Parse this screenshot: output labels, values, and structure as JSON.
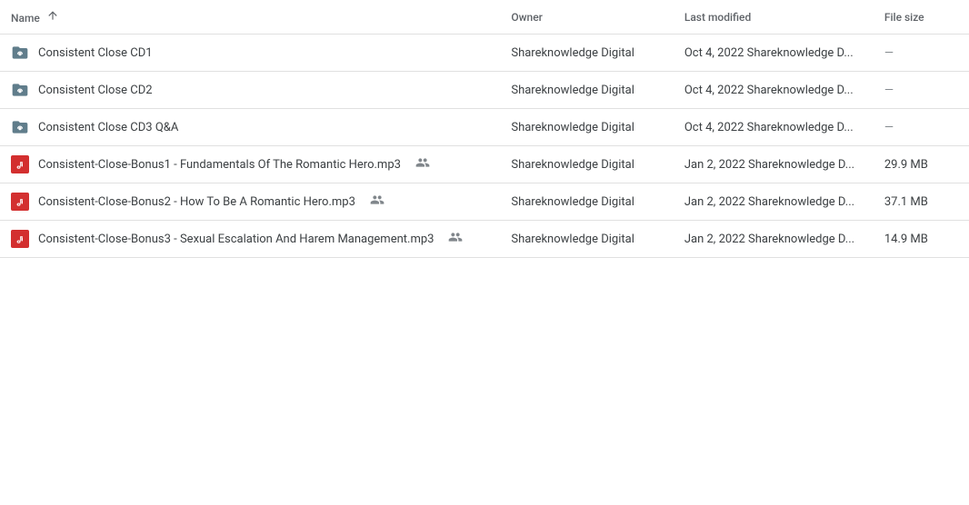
{
  "header": {
    "name_label": "Name",
    "owner_label": "Owner",
    "modified_label": "Last modified",
    "size_label": "File size"
  },
  "rows": [
    {
      "id": "row-1",
      "type": "folder",
      "name": "Consistent Close CD1",
      "has_shared": false,
      "owner": "Shareknowledge Digital",
      "modified": "Oct 4, 2022",
      "modified_by": "Shareknowledge D...",
      "size": "—"
    },
    {
      "id": "row-2",
      "type": "folder",
      "name": "Consistent Close CD2",
      "has_shared": false,
      "owner": "Shareknowledge Digital",
      "modified": "Oct 4, 2022",
      "modified_by": "Shareknowledge D...",
      "size": "—"
    },
    {
      "id": "row-3",
      "type": "folder",
      "name": "Consistent Close CD3 Q&A",
      "has_shared": false,
      "owner": "Shareknowledge Digital",
      "modified": "Oct 4, 2022",
      "modified_by": "Shareknowledge D...",
      "size": "—"
    },
    {
      "id": "row-4",
      "type": "mp3",
      "name": "Consistent-Close-Bonus1 - Fundamentals Of The Romantic Hero.mp3",
      "has_shared": true,
      "owner": "Shareknowledge Digital",
      "modified": "Jan 2, 2022",
      "modified_by": "Shareknowledge D...",
      "size": "29.9 MB"
    },
    {
      "id": "row-5",
      "type": "mp3",
      "name": "Consistent-Close-Bonus2 - How To Be A Romantic Hero.mp3",
      "has_shared": true,
      "owner": "Shareknowledge Digital",
      "modified": "Jan 2, 2022",
      "modified_by": "Shareknowledge D...",
      "size": "37.1 MB"
    },
    {
      "id": "row-6",
      "type": "mp3",
      "name": "Consistent-Close-Bonus3 - Sexual Escalation And Harem Management.mp3",
      "has_shared": true,
      "owner": "Shareknowledge Digital",
      "modified": "Jan 2, 2022",
      "modified_by": "Shareknowledge D...",
      "size": "14.9 MB"
    }
  ]
}
